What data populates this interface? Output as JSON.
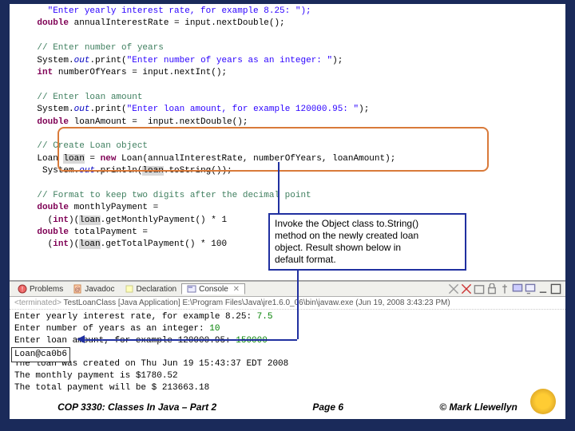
{
  "code": {
    "l1": "      \"Enter yearly interest rate, for example 8.25: \");",
    "l2a": "    double",
    "l2b": " annualInterestRate = input.nextDouble();",
    "l3": "    // Enter number of years",
    "l4a": "    System.",
    "l4o": "out",
    "l4b": ".print(",
    "l4s": "\"Enter number of years as an integer: \"",
    "l4c": ");",
    "l5a": "    int",
    "l5b": " numberOfYears = input.nextInt();",
    "l6": "    // Enter loan amount",
    "l7a": "    System.",
    "l7o": "out",
    "l7b": ".print(",
    "l7s": "\"Enter loan amount, for example 120000.95: \"",
    "l7c": ");",
    "l8a": "    double",
    "l8b": " loanAmount =  input.nextDouble();",
    "l9": "    // Create Loan object",
    "l10a": "    Loan ",
    "l10v": "loan",
    "l10b": " = ",
    "l10n": "new",
    "l10c": " Loan(annualInterestRate, numberOfYears, loanAmount);",
    "l11a": "     System.",
    "l11o": "out",
    "l11b": ".println(",
    "l11v": "loan",
    "l11c": ".toString());",
    "l12": "    // Format to keep two digits after the decimal point",
    "l13a": "    double",
    "l13b": " monthlyPayment = ",
    "l14a": "      (",
    "l14k": "int",
    "l14b": ")(",
    "l14v": "loan",
    "l14c": ".getMonthlyPayment() * 1",
    "l15a": "    double",
    "l15b": " totalPayment = ",
    "l16a": "      (",
    "l16k": "int",
    "l16b": ")(",
    "l16v": "loan",
    "l16c": ".getTotalPayment() * 100"
  },
  "note": {
    "l1": "Invoke the Object class to.String()",
    "l2": "method on the newly created loan",
    "l3": "object.  Result shown below in",
    "l4": "default format."
  },
  "tabs": {
    "problems": "Problems",
    "javadoc": "Javadoc",
    "declaration": "Declaration",
    "console": "Console"
  },
  "consoleHeader": {
    "term": "<terminated>",
    "title": " TestLoanClass [Java Application] E:\\Program Files\\Java\\jre1.6.0_06\\bin\\javaw.exe (Jun 19, 2008 3:43:23 PM)"
  },
  "console": {
    "l1a": "Enter yearly interest rate, for example 8.25: ",
    "l1b": "7.5",
    "l2a": "Enter number of years as an integer: ",
    "l2b": "10",
    "l3a": "Enter loan amount, for example 120000.95: ",
    "l3b": "150000",
    "l4": "Loan@ca0b6",
    "l5": "The loan was created on Thu Jun 19 15:43:37 EDT 2008",
    "l6": "The monthly payment is $1780.52",
    "l7": "The total payment will be $ 213663.18"
  },
  "footer": {
    "course": "COP 3330:  Classes In Java – Part 2",
    "page": "Page 6",
    "copyright": "© Mark Llewellyn"
  }
}
